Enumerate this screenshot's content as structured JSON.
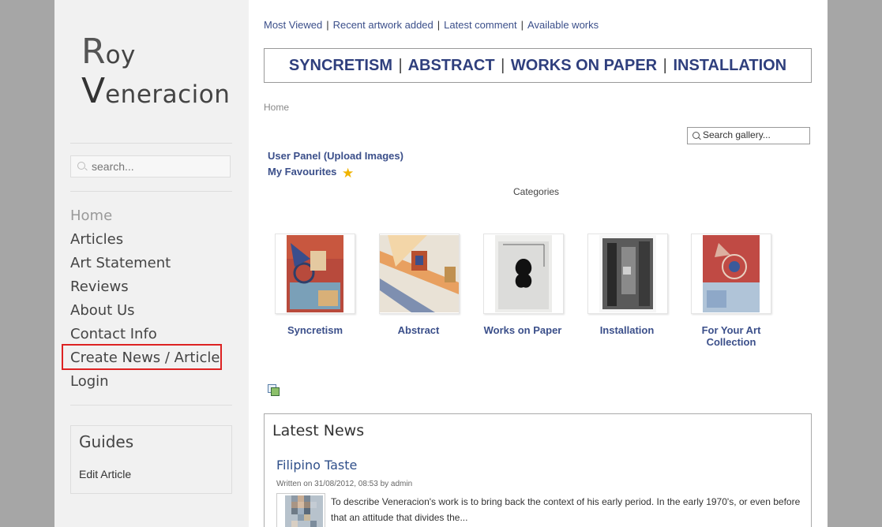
{
  "sidebar": {
    "logo": {
      "first_initial": "R",
      "first_rest": "oy",
      "last_initial": "V",
      "last_rest": "eneracion"
    },
    "search_placeholder": "search...",
    "nav": [
      {
        "label": "Home"
      },
      {
        "label": "Articles"
      },
      {
        "label": "Art Statement"
      },
      {
        "label": "Reviews"
      },
      {
        "label": "About Us"
      },
      {
        "label": "Contact Info"
      },
      {
        "label": "Create News / Article"
      },
      {
        "label": "Login"
      }
    ],
    "guides": {
      "title": "Guides",
      "link": "Edit Article"
    }
  },
  "main": {
    "toplinks": [
      "Most Viewed",
      "Recent artwork added",
      "Latest comment",
      "Available works"
    ],
    "category_bar": [
      "SYNCRETISM",
      "ABSTRACT",
      "WORKS ON PAPER",
      "INSTALLATION"
    ],
    "breadcrumb": "Home",
    "gallery_search_placeholder": "Search gallery...",
    "user_panel": "User Panel (Upload Images)",
    "favourites": "My Favourites",
    "categories_heading": "Categories",
    "categories": [
      {
        "label": "Syncretism"
      },
      {
        "label": "Abstract"
      },
      {
        "label": "Works on Paper"
      },
      {
        "label": "Installation"
      },
      {
        "label": "For Your Art Collection"
      }
    ],
    "latest_news": {
      "heading": "Latest News",
      "article_title": "Filipino Taste",
      "meta": "Written on 31/08/2012, 08:53 by admin",
      "excerpt": "To describe Veneracion's work is to bring back the context of his early period. In the early 1970's, or even before that an attitude that divides the..."
    }
  },
  "colors": {
    "link": "#3b4f8a",
    "highlight_border": "#dd2222",
    "sidebar_bg": "#f1f1f1",
    "outer_bg": "#a6a6a6"
  },
  "icons": [
    "search-icon",
    "star-icon",
    "gallery-icon"
  ]
}
